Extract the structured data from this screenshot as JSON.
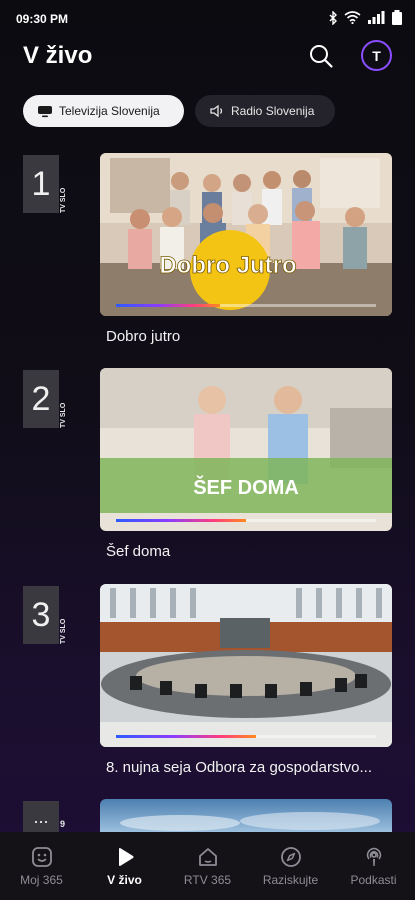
{
  "status_bar": {
    "time": "09:30 PM"
  },
  "header": {
    "title": "V živo",
    "avatar_letter": "T"
  },
  "tabs": [
    {
      "label": "Televizija Slovenija",
      "active": true
    },
    {
      "label": "Radio Slovenija",
      "active": false
    }
  ],
  "channels": [
    {
      "number": "1",
      "tag": "TV SLO",
      "title": "Dobro jutro",
      "thumb_text": "Dobro Jutro",
      "progress_pct": 40
    },
    {
      "number": "2",
      "tag": "TV SLO",
      "title": "Šef doma",
      "thumb_text": "ŠEF DOMA",
      "progress_pct": 50
    },
    {
      "number": "3",
      "tag": "TV SLO",
      "title": "8. nujna seja Odbora za gospodarstvo...",
      "progress_pct": 54
    },
    {
      "number": "...",
      "tag": "9"
    }
  ],
  "bottom_nav": [
    {
      "label": "Moj 365",
      "icon": "smile-box-icon",
      "active": false
    },
    {
      "label": "V živo",
      "icon": "play-icon",
      "active": true
    },
    {
      "label": "RTV 365",
      "icon": "home-icon",
      "active": false
    },
    {
      "label": "Raziskujte",
      "icon": "compass-icon",
      "active": false
    },
    {
      "label": "Podkasti",
      "icon": "podcast-icon",
      "active": false
    }
  ],
  "colors": {
    "accent": "#8a4dff",
    "progress_start": "#2d5bff",
    "progress_end": "#ff8a1f",
    "active_tab_bg": "#f2f2f4"
  }
}
